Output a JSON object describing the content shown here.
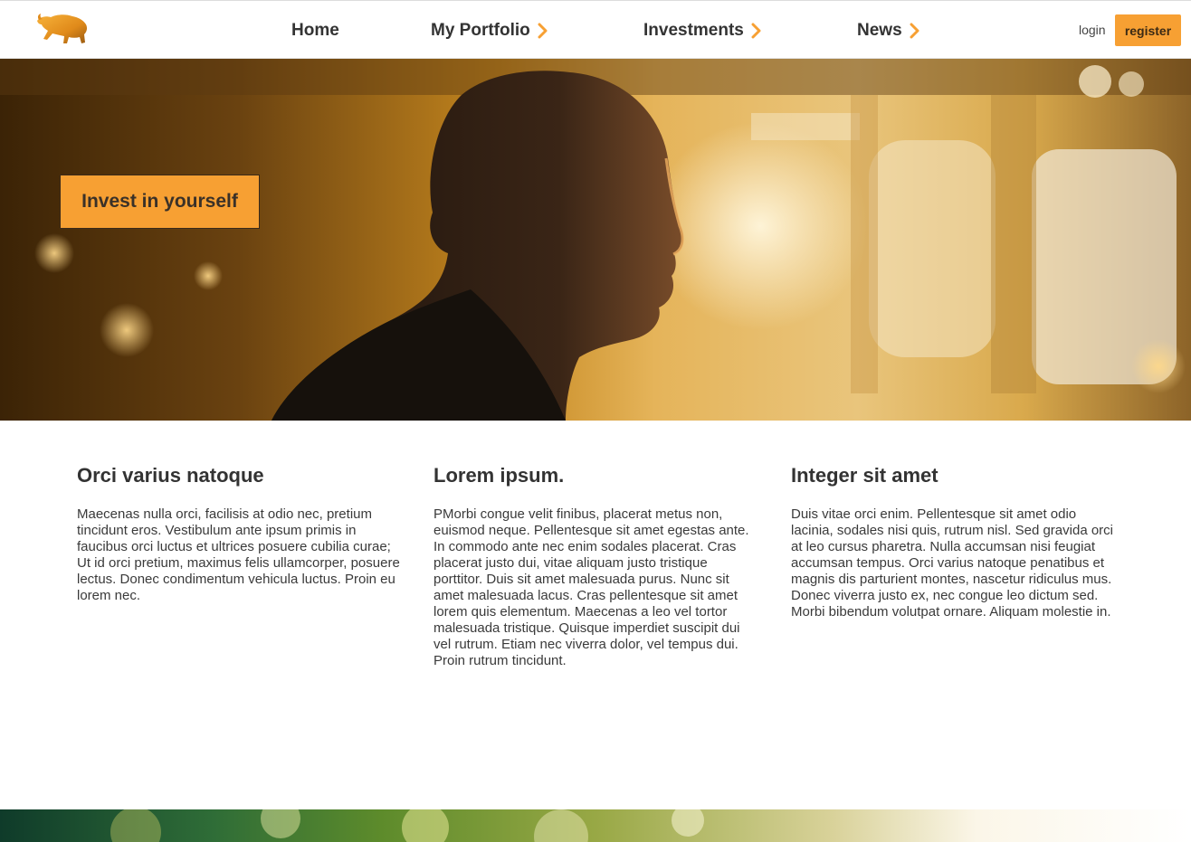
{
  "header": {
    "logo_icon": "charging-bull-icon",
    "nav": [
      {
        "label": "Home",
        "has_chevron": false
      },
      {
        "label": "My Portfolio",
        "has_chevron": true
      },
      {
        "label": "Investments",
        "has_chevron": true
      },
      {
        "label": "News",
        "has_chevron": true
      }
    ],
    "login_label": "login",
    "register_label": "register"
  },
  "hero": {
    "cta_label": "Invest in yourself"
  },
  "columns": [
    {
      "title": "Orci varius natoque",
      "body": "Maecenas nulla orci, facilisis at odio nec, pretium tincidunt eros. Vestibulum ante ipsum primis in faucibus orci luctus et ultrices posuere cubilia curae; Ut id orci pretium, maximus felis ullamcorper, posuere lectus. Donec condimentum vehicula luctus. Proin eu lorem nec."
    },
    {
      "title": "Lorem ipsum.",
      "body": "PMorbi congue velit finibus, placerat metus non, euismod neque. Pellentesque sit amet egestas ante. In commodo ante nec enim sodales placerat. Cras placerat justo dui, vitae aliquam justo tristique porttitor. Duis sit amet malesuada purus. Nunc sit amet malesuada lacus. Cras pellentesque sit amet lorem quis elementum. Maecenas a leo vel tortor malesuada tristique. Quisque imperdiet suscipit dui vel rutrum. Etiam nec viverra dolor, vel tempus dui. Proin rutrum tincidunt."
    },
    {
      "title": "Integer sit amet",
      "body": "Duis vitae orci enim. Pellentesque sit amet odio lacinia, sodales nisi quis, rutrum nisl. Sed gravida orci at leo cursus pharetra. Nulla accumsan nisi feugiat accumsan tempus. Orci varius natoque penatibus et magnis dis parturient montes, nascetur ridiculus mus. Donec viverra justo ex, nec congue leo dictum sed. Morbi bibendum volutpat ornare. Aliquam molestie in."
    }
  ],
  "colors": {
    "accent": "#f7a033",
    "text": "#333333"
  }
}
